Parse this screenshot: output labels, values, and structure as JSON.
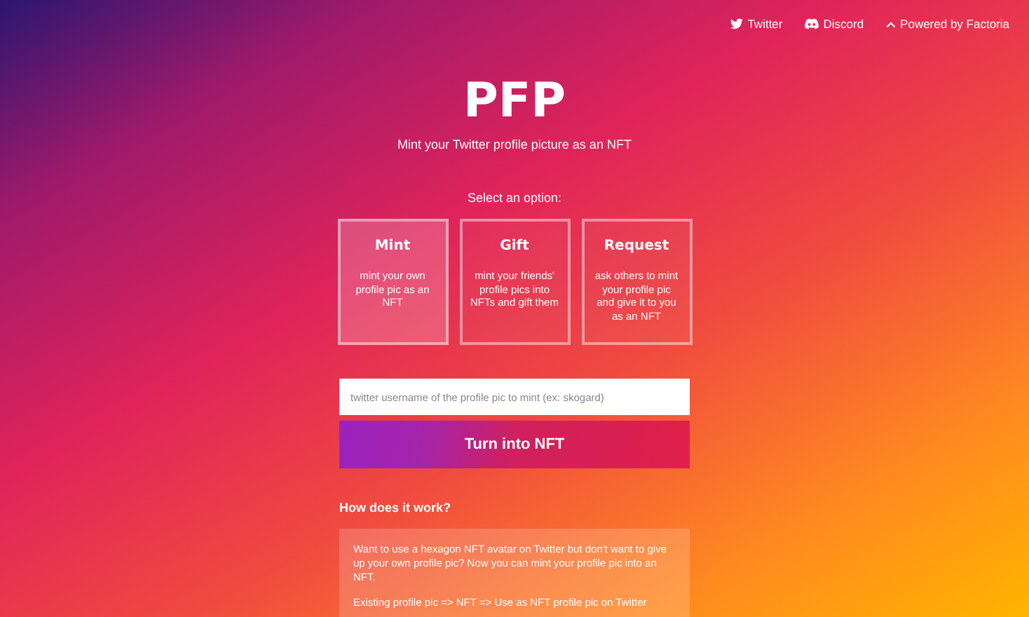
{
  "nav_links": [
    {
      "label": "Twitter",
      "kind": "twitter"
    },
    {
      "label": "Discord",
      "kind": "discord"
    },
    {
      "label": "Powered by Factoria",
      "kind": "caret"
    }
  ],
  "title": "PFP",
  "subtitle": "Mint your Twitter profile picture as an NFT",
  "options_label": "Select an option:",
  "options": [
    {
      "title": "Mint",
      "description": "mint your own profile pic as an NFT",
      "selected": true
    },
    {
      "title": "Gift",
      "description": "mint your friends' profile pics into NFTs and gift them",
      "selected": false
    },
    {
      "title": "Request",
      "description": "ask others to mint your profile pic and give it to you as an NFT",
      "selected": false
    }
  ],
  "username_field": {
    "placeholder": "twitter username of the profile pic to mint (ex: skogard)"
  },
  "submit_button": "Turn into NFT",
  "how_it_works": {
    "heading": "How does it work?",
    "paragraphs": [
      "Want to use a hexagon NFT avatar on Twitter but don't want to give up your own profile pic? Now you can mint your profile pic into an NFT.",
      "Existing profile pic => NFT => Use as NFT profile pic on Twitter"
    ]
  }
}
